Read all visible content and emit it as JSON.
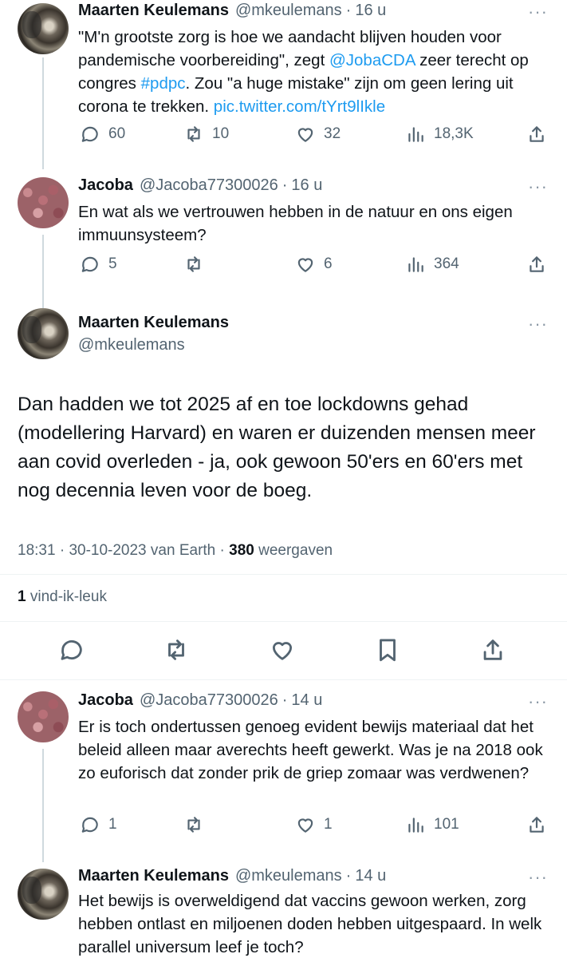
{
  "tweet1": {
    "name": "Maarten Keulemans",
    "handle": "@mkeulemans",
    "time": "16 u",
    "text_parts": {
      "a": "\"M'n grootste zorg is hoe we aandacht blijven houden voor pandemische voorbereiding\", zegt ",
      "mention": "@JobaCDA",
      "b": " zeer terecht op congres ",
      "hashtag": "#pdpc",
      "c": ". Zou \"a huge mistake\" zijn om geen lering uit corona te trekken. ",
      "link": "pic.twitter.com/tYrt9lIkle"
    },
    "replies": "60",
    "retweets": "10",
    "likes": "32",
    "views": "18,3K"
  },
  "tweet2": {
    "name": "Jacoba",
    "handle": "@Jacoba77300026",
    "time": "16 u",
    "text": "En wat als we vertrouwen hebben in de natuur en ons eigen immuunsysteem?",
    "replies": "5",
    "retweets": "",
    "likes": "6",
    "views": "364"
  },
  "main": {
    "name": "Maarten Keulemans",
    "handle": "@mkeulemans",
    "text": "Dan hadden we tot 2025 af en toe lockdowns gehad (modellering Harvard) en waren er duizenden mensen meer aan covid overleden - ja, ook gewoon 50'ers en 60'ers met nog decennia leven voor de boeg.",
    "time": "18:31",
    "date": "30-10-2023",
    "source": "van Earth",
    "views_count": "380",
    "views_label": "weergaven",
    "likes_count": "1",
    "likes_label": "vind-ik-leuk"
  },
  "tweet3": {
    "name": "Jacoba",
    "handle": "@Jacoba77300026",
    "time": "14 u",
    "text": "Er is toch ondertussen genoeg evident bewijs materiaal dat het beleid alleen maar averechts heeft gewerkt. Was je na 2018 ook zo euforisch dat zonder prik de griep zomaar was verdwenen?",
    "replies": "1",
    "retweets": "",
    "likes": "1",
    "views": "101"
  },
  "tweet4": {
    "name": "Maarten Keulemans",
    "handle": "@mkeulemans",
    "time": "14 u",
    "text": "Het bewijs is overweldigend dat vaccins gewoon werken, zorg hebben ontlast en miljoenen doden hebben uitgespaard. In welk parallel universum leef je toch?"
  },
  "ui": {
    "separator": "·",
    "more_glyph": "···",
    "accent_color": "#1d9bf0",
    "icons": [
      "reply-icon",
      "retweet-icon",
      "like-icon",
      "views-icon",
      "share-icon",
      "bookmark-icon",
      "more-icon"
    ]
  }
}
